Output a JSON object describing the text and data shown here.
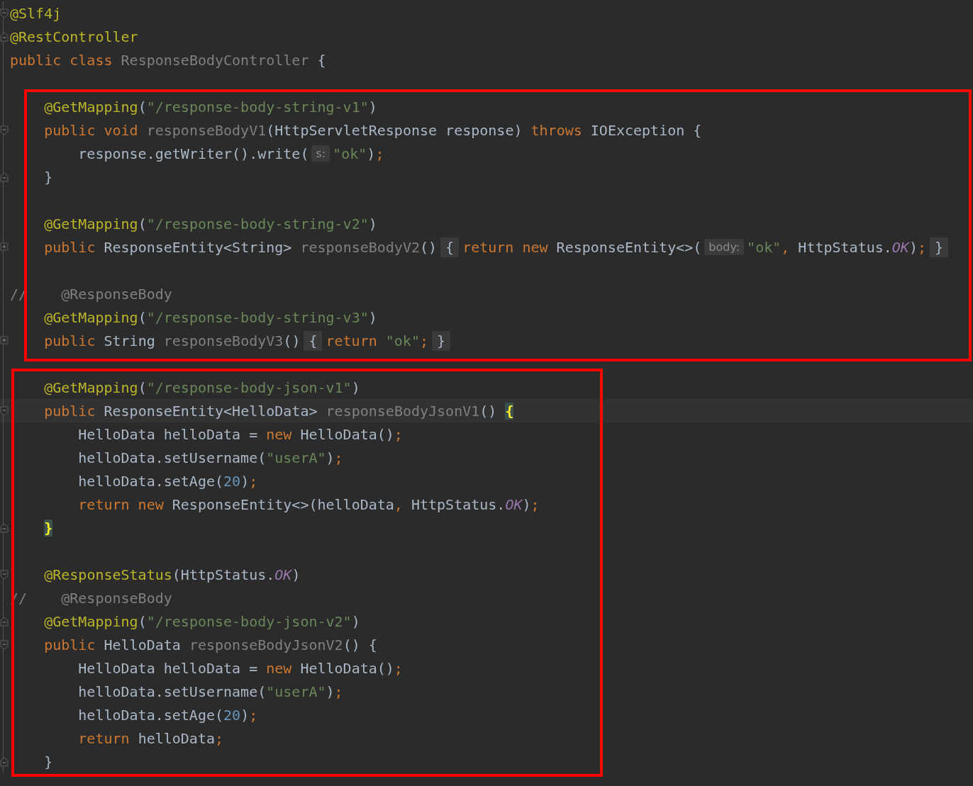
{
  "editor": {
    "blocks": [
      {
        "kind": "plain",
        "lines": [
          {
            "kind": "fold-start",
            "tokens": [
              {
                "kind": "ann",
                "text": "@Slf4j"
              }
            ]
          },
          {
            "kind": "fold-end",
            "tokens": [
              {
                "kind": "ann",
                "text": "@RestController"
              }
            ]
          },
          {
            "kind": "plain",
            "tokens": [
              {
                "kind": "kw",
                "text": "public class "
              },
              {
                "kind": "dim",
                "text": "ResponseBodyController"
              },
              {
                "kind": "txt",
                "text": " {"
              }
            ]
          },
          {
            "kind": "blank"
          }
        ]
      },
      {
        "kind": "outlined-wide",
        "lines": [
          {
            "kind": "plain",
            "tokens": [
              {
                "kind": "ann",
                "text": "    @GetMapping"
              },
              {
                "kind": "txt",
                "text": "("
              },
              {
                "kind": "str",
                "text": "\"/response-body-string-v1\""
              },
              {
                "kind": "txt",
                "text": ")"
              }
            ]
          },
          {
            "kind": "fold-start",
            "tokens": [
              {
                "kind": "kw",
                "text": "    public void "
              },
              {
                "kind": "dim",
                "text": "responseBodyV1"
              },
              {
                "kind": "txt",
                "text": "(HttpServletResponse response) "
              },
              {
                "kind": "kw",
                "text": "throws "
              },
              {
                "kind": "txt",
                "text": "IOException {"
              }
            ]
          },
          {
            "kind": "plain",
            "tokens": [
              {
                "kind": "txt",
                "text": "        response.getWriter().write("
              },
              {
                "kind": "hint",
                "text": "s:"
              },
              {
                "kind": "str",
                "text": "\"ok\""
              },
              {
                "kind": "txt",
                "text": ")"
              },
              {
                "kind": "kw",
                "text": ";"
              }
            ]
          },
          {
            "kind": "fold-end",
            "tokens": [
              {
                "kind": "txt",
                "text": "    }"
              }
            ]
          },
          {
            "kind": "blank"
          },
          {
            "kind": "plain",
            "tokens": [
              {
                "kind": "ann",
                "text": "    @GetMapping"
              },
              {
                "kind": "txt",
                "text": "("
              },
              {
                "kind": "str",
                "text": "\"/response-body-string-v2\""
              },
              {
                "kind": "txt",
                "text": ")"
              }
            ]
          },
          {
            "kind": "folded",
            "tokens": [
              {
                "kind": "kw",
                "text": "    public "
              },
              {
                "kind": "txt",
                "text": "ResponseEntity<String> "
              },
              {
                "kind": "dim",
                "text": "responseBodyV2"
              },
              {
                "kind": "txt",
                "text": "()"
              },
              {
                "kind": "folded",
                "text": "{"
              },
              {
                "kind": "kw",
                "text": "return new "
              },
              {
                "kind": "txt",
                "text": "ResponseEntity<>("
              },
              {
                "kind": "hint",
                "text": "body:"
              },
              {
                "kind": "str",
                "text": "\"ok\""
              },
              {
                "kind": "kw",
                "text": ", "
              },
              {
                "kind": "txt",
                "text": "HttpStatus."
              },
              {
                "kind": "const",
                "text": "OK"
              },
              {
                "kind": "txt",
                "text": ")"
              },
              {
                "kind": "kw",
                "text": ";"
              },
              {
                "kind": "folded",
                "text": "}"
              }
            ]
          },
          {
            "kind": "blank"
          },
          {
            "kind": "plain",
            "tokens": [
              {
                "kind": "com",
                "text": "//    @ResponseBody"
              }
            ]
          },
          {
            "kind": "plain",
            "tokens": [
              {
                "kind": "ann",
                "text": "    @GetMapping"
              },
              {
                "kind": "txt",
                "text": "("
              },
              {
                "kind": "str",
                "text": "\"/response-body-string-v3\""
              },
              {
                "kind": "txt",
                "text": ")"
              }
            ]
          },
          {
            "kind": "folded",
            "tokens": [
              {
                "kind": "kw",
                "text": "    public "
              },
              {
                "kind": "txt",
                "text": "String "
              },
              {
                "kind": "dim",
                "text": "responseBodyV3"
              },
              {
                "kind": "txt",
                "text": "()"
              },
              {
                "kind": "folded",
                "text": "{"
              },
              {
                "kind": "kw",
                "text": "return "
              },
              {
                "kind": "str",
                "text": "\"ok\""
              },
              {
                "kind": "kw",
                "text": ";"
              },
              {
                "kind": "folded",
                "text": "}"
              }
            ]
          }
        ]
      },
      {
        "kind": "plain",
        "lines": [
          {
            "kind": "blank"
          }
        ]
      },
      {
        "kind": "outlined-narrow",
        "lines": [
          {
            "kind": "plain",
            "tokens": [
              {
                "kind": "ann",
                "text": "    @GetMapping"
              },
              {
                "kind": "txt",
                "text": "("
              },
              {
                "kind": "str",
                "text": "\"/response-body-json-v1\""
              },
              {
                "kind": "txt",
                "text": ")"
              }
            ]
          },
          {
            "kind": "fold-start",
            "current": true,
            "tokens": [
              {
                "kind": "kw",
                "text": "    public "
              },
              {
                "kind": "txt",
                "text": "ResponseEntity<HelloData> "
              },
              {
                "kind": "dim",
                "text": "responseBodyJsonV1"
              },
              {
                "kind": "txt",
                "text": "() "
              },
              {
                "kind": "match",
                "text": "{"
              }
            ]
          },
          {
            "kind": "plain",
            "tokens": [
              {
                "kind": "txt",
                "text": "        HelloData helloData = "
              },
              {
                "kind": "kw",
                "text": "new "
              },
              {
                "kind": "txt",
                "text": "HelloData()"
              },
              {
                "kind": "kw",
                "text": ";"
              }
            ]
          },
          {
            "kind": "plain",
            "tokens": [
              {
                "kind": "txt",
                "text": "        helloData.setUsername("
              },
              {
                "kind": "str",
                "text": "\"userA\""
              },
              {
                "kind": "txt",
                "text": ")"
              },
              {
                "kind": "kw",
                "text": ";"
              }
            ]
          },
          {
            "kind": "plain",
            "tokens": [
              {
                "kind": "txt",
                "text": "        helloData.setAge("
              },
              {
                "kind": "num",
                "text": "20"
              },
              {
                "kind": "txt",
                "text": ")"
              },
              {
                "kind": "kw",
                "text": ";"
              }
            ]
          },
          {
            "kind": "plain",
            "tokens": [
              {
                "kind": "kw",
                "text": "        return new "
              },
              {
                "kind": "txt",
                "text": "ResponseEntity<>(helloData"
              },
              {
                "kind": "kw",
                "text": ", "
              },
              {
                "kind": "txt",
                "text": "HttpStatus."
              },
              {
                "kind": "const",
                "text": "OK"
              },
              {
                "kind": "txt",
                "text": ")"
              },
              {
                "kind": "kw",
                "text": ";"
              }
            ]
          },
          {
            "kind": "fold-end",
            "tokens": [
              {
                "kind": "match",
                "text": "    }"
              }
            ]
          },
          {
            "kind": "blank"
          },
          {
            "kind": "fold-start",
            "tokens": [
              {
                "kind": "ann",
                "text": "    @ResponseStatus"
              },
              {
                "kind": "txt",
                "text": "(HttpStatus."
              },
              {
                "kind": "const",
                "text": "OK"
              },
              {
                "kind": "txt",
                "text": ")"
              }
            ]
          },
          {
            "kind": "plain",
            "tokens": [
              {
                "kind": "com",
                "text": "//    @ResponseBody"
              }
            ]
          },
          {
            "kind": "fold-end",
            "tokens": [
              {
                "kind": "ann",
                "text": "    @GetMapping"
              },
              {
                "kind": "txt",
                "text": "("
              },
              {
                "kind": "str",
                "text": "\"/response-body-json-v2\""
              },
              {
                "kind": "txt",
                "text": ")"
              }
            ]
          },
          {
            "kind": "fold-start",
            "tokens": [
              {
                "kind": "kw",
                "text": "    public "
              },
              {
                "kind": "txt",
                "text": "HelloData "
              },
              {
                "kind": "dim",
                "text": "responseBodyJsonV2"
              },
              {
                "kind": "txt",
                "text": "() {"
              }
            ]
          },
          {
            "kind": "plain",
            "tokens": [
              {
                "kind": "txt",
                "text": "        HelloData helloData = "
              },
              {
                "kind": "kw",
                "text": "new "
              },
              {
                "kind": "txt",
                "text": "HelloData()"
              },
              {
                "kind": "kw",
                "text": ";"
              }
            ]
          },
          {
            "kind": "plain",
            "tokens": [
              {
                "kind": "txt",
                "text": "        helloData.setUsername("
              },
              {
                "kind": "str",
                "text": "\"userA\""
              },
              {
                "kind": "txt",
                "text": ")"
              },
              {
                "kind": "kw",
                "text": ";"
              }
            ]
          },
          {
            "kind": "plain",
            "tokens": [
              {
                "kind": "txt",
                "text": "        helloData.setAge("
              },
              {
                "kind": "num",
                "text": "20"
              },
              {
                "kind": "txt",
                "text": ")"
              },
              {
                "kind": "kw",
                "text": ";"
              }
            ]
          },
          {
            "kind": "plain",
            "tokens": [
              {
                "kind": "kw",
                "text": "        return "
              },
              {
                "kind": "txt",
                "text": "helloData"
              },
              {
                "kind": "kw",
                "text": ";"
              }
            ]
          },
          {
            "kind": "fold-end",
            "tokens": [
              {
                "kind": "txt",
                "text": "    }"
              }
            ]
          }
        ]
      }
    ]
  }
}
